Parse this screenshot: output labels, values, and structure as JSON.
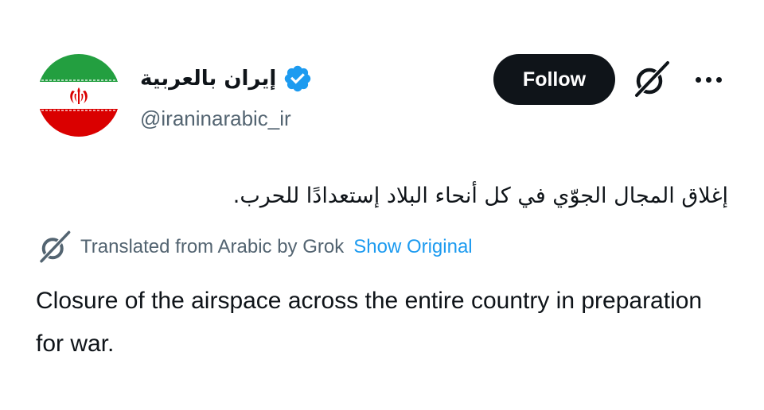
{
  "post": {
    "author": {
      "display_name": "إيران بالعربية",
      "handle": "@iraninarabic_ir",
      "verified": true,
      "avatar_icon": "iran-flag-icon"
    },
    "actions": {
      "follow_label": "Follow",
      "grok_icon": "grok-icon",
      "more_icon": "more-options-icon"
    },
    "original_text": "إغلاق المجال الجوّي في كل أنحاء البلاد إستعدادًا للحرب.",
    "translation": {
      "label": "Translated from Arabic by Grok",
      "show_original_label": "Show Original",
      "text": "Closure of the airspace across the entire country in preparation for war."
    }
  },
  "colors": {
    "text": "#0f1419",
    "secondary": "#536471",
    "link": "#1d9bf0",
    "verified": "#1d9bf0",
    "flag_green": "#239f40",
    "flag_red": "#da0000"
  }
}
